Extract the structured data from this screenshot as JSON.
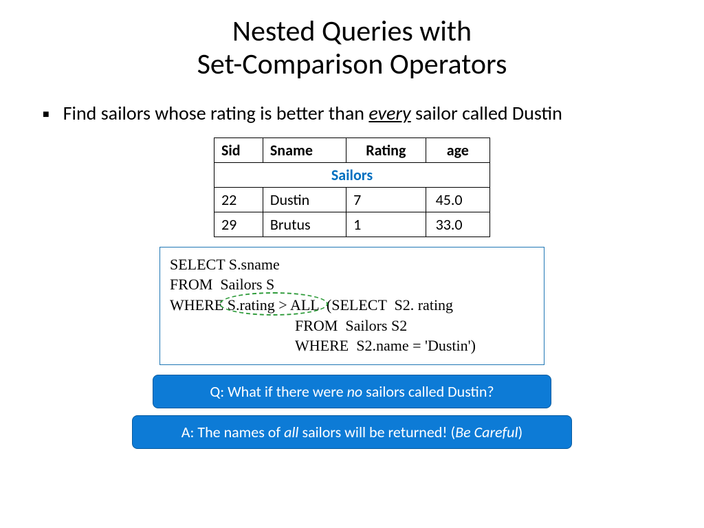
{
  "title": {
    "line1": "Nested Queries with",
    "line2": "Set-Comparison Operators"
  },
  "bullet": {
    "prefix": "Find sailors whose rating is better than ",
    "emph": "every",
    "suffix": " sailor called Dustin"
  },
  "table": {
    "caption": "Sailors",
    "headers": {
      "c1": "Sid",
      "c2": "Sname",
      "c3": "Rating",
      "c4": "age"
    },
    "rows": [
      {
        "sid": "22",
        "sname": "Dustin",
        "rating": "7",
        "age": "45.0"
      },
      {
        "sid": "29",
        "sname": "Brutus",
        "rating": "1",
        "age": "33.0"
      }
    ]
  },
  "query": {
    "l1a": "SELECT",
    "l1b": "  S.sname",
    "l2a": "FROM",
    "l2b": "  Sailors S",
    "l3a": "WHERE",
    "l3b": " S.rating > ALL  (",
    "l3c": "SELECT",
    "l3d": "  S2. rating",
    "l4a": "FROM",
    "l4b": "  Sailors S2",
    "l5a": "WHERE",
    "l5b": "  S2.name = 'Dustin')"
  },
  "qa": {
    "q_prefix": "Q: What if there were ",
    "q_emph": "no",
    "q_suffix": " sailors called Dustin?",
    "a_prefix": "A: The names of ",
    "a_emph1": "all",
    "a_mid": " sailors will be returned! (",
    "a_emph2": "Be Careful",
    "a_suffix": ")"
  }
}
